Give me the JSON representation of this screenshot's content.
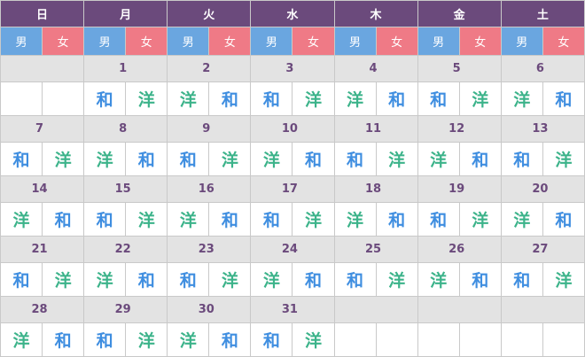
{
  "weekdays": [
    "日",
    "月",
    "火",
    "水",
    "木",
    "金",
    "土"
  ],
  "gender": {
    "male": "男",
    "female": "女"
  },
  "weeks": [
    {
      "dates": [
        "",
        "1",
        "2",
        "3",
        "4",
        "5",
        "6"
      ],
      "meals": [
        [
          "",
          ""
        ],
        [
          "和",
          "洋"
        ],
        [
          "洋",
          "和"
        ],
        [
          "和",
          "洋"
        ],
        [
          "洋",
          "和"
        ],
        [
          "和",
          "洋"
        ],
        [
          "洋",
          "和"
        ]
      ]
    },
    {
      "dates": [
        "7",
        "8",
        "9",
        "10",
        "11",
        "12",
        "13"
      ],
      "meals": [
        [
          "和",
          "洋"
        ],
        [
          "洋",
          "和"
        ],
        [
          "和",
          "洋"
        ],
        [
          "洋",
          "和"
        ],
        [
          "和",
          "洋"
        ],
        [
          "洋",
          "和"
        ],
        [
          "和",
          "洋"
        ]
      ]
    },
    {
      "dates": [
        "14",
        "15",
        "16",
        "17",
        "18",
        "19",
        "20"
      ],
      "meals": [
        [
          "洋",
          "和"
        ],
        [
          "和",
          "洋"
        ],
        [
          "洋",
          "和"
        ],
        [
          "和",
          "洋"
        ],
        [
          "洋",
          "和"
        ],
        [
          "和",
          "洋"
        ],
        [
          "洋",
          "和"
        ]
      ]
    },
    {
      "dates": [
        "21",
        "22",
        "23",
        "24",
        "25",
        "26",
        "27"
      ],
      "meals": [
        [
          "和",
          "洋"
        ],
        [
          "洋",
          "和"
        ],
        [
          "和",
          "洋"
        ],
        [
          "洋",
          "和"
        ],
        [
          "和",
          "洋"
        ],
        [
          "洋",
          "和"
        ],
        [
          "和",
          "洋"
        ]
      ]
    },
    {
      "dates": [
        "28",
        "29",
        "30",
        "31",
        "",
        "",
        ""
      ],
      "meals": [
        [
          "洋",
          "和"
        ],
        [
          "和",
          "洋"
        ],
        [
          "洋",
          "和"
        ],
        [
          "和",
          "洋"
        ],
        [
          "",
          ""
        ],
        [
          "",
          ""
        ],
        [
          "",
          ""
        ]
      ]
    }
  ],
  "colors": {
    "header_bg": "#6b4a7c",
    "male_bg": "#6aa6e0",
    "female_bg": "#ef7a86",
    "date_row_bg": "#e3e3e3",
    "wa_text": "#3f8ee0",
    "yo_text": "#3cb38a"
  }
}
